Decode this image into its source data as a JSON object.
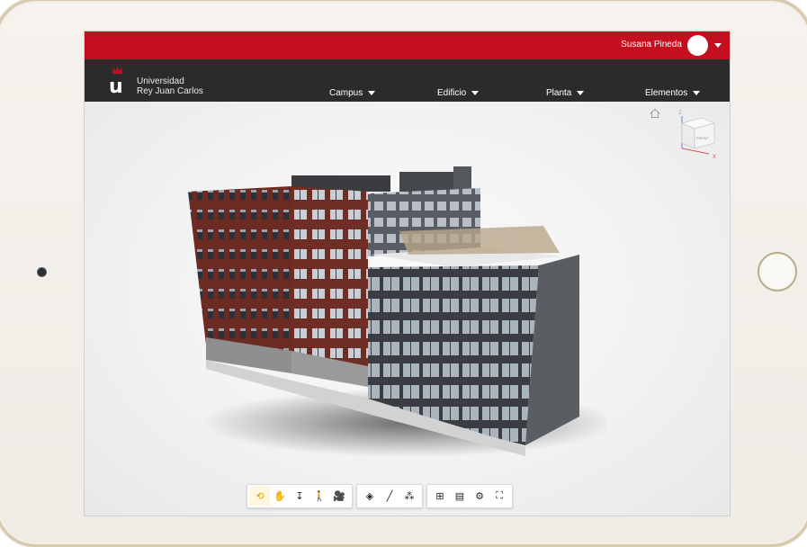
{
  "header": {
    "user_name": "Susana Pineda"
  },
  "brand": {
    "letter": "u",
    "line1": "Universidad",
    "line2": "Rey Juan Carlos",
    "accent_color": "#c50f1f"
  },
  "nav": {
    "items": [
      {
        "label": "Campus"
      },
      {
        "label": "Edificio"
      },
      {
        "label": "Planta"
      },
      {
        "label": "Elementos"
      }
    ]
  },
  "viewcube": {
    "face_label": "FRONT",
    "axis_z": "Z",
    "axis_x": "X"
  },
  "toolbar": {
    "groups": [
      [
        {
          "icon": "orbit-icon",
          "glyph": "⟲",
          "active": true
        },
        {
          "icon": "pan-hand-icon",
          "glyph": "✋"
        },
        {
          "icon": "zoom-icon",
          "glyph": "↧"
        },
        {
          "icon": "first-person-icon",
          "glyph": "🚶"
        },
        {
          "icon": "camera-icon",
          "glyph": "🎥"
        }
      ],
      [
        {
          "icon": "section-box-icon",
          "glyph": "◈"
        },
        {
          "icon": "measure-icon",
          "glyph": "╱"
        },
        {
          "icon": "explode-icon",
          "glyph": "⁂"
        }
      ],
      [
        {
          "icon": "model-browser-icon",
          "glyph": "⊞"
        },
        {
          "icon": "properties-icon",
          "glyph": "▤"
        },
        {
          "icon": "settings-gear-icon",
          "glyph": "⚙"
        },
        {
          "icon": "fullscreen-icon",
          "glyph": "⛶"
        }
      ]
    ]
  }
}
